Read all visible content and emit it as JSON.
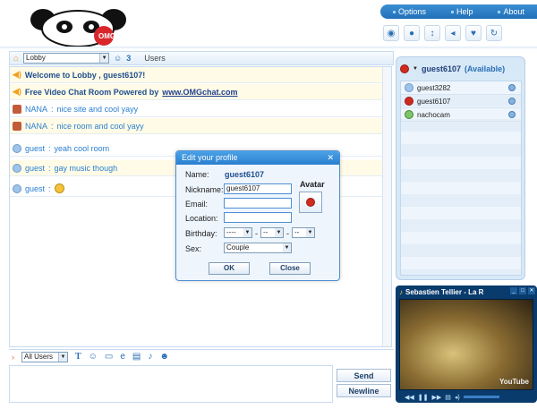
{
  "header": {
    "menu": [
      "Options",
      "Help",
      "About"
    ],
    "logo_text": "OMG"
  },
  "toolbar_icons": [
    "gamepad-icon",
    "webcam-icon",
    "resize-icon",
    "volume-icon",
    "heart-icon",
    "refresh-icon"
  ],
  "room": {
    "selected": "Lobby",
    "count": "3",
    "users_label": "Users"
  },
  "messages": [
    {
      "type": "sys",
      "text": "Welcome to Lobby , guest6107!"
    },
    {
      "type": "sys",
      "text": "Free Video Chat Room Powered by ",
      "link": "www.OMGchat.com"
    },
    {
      "type": "user",
      "user": "NANA",
      "text": "nice site and cool yayy",
      "avatar": "nana"
    },
    {
      "type": "user",
      "user": "NANA",
      "text": "nice room and cool yayy",
      "avatar": "nana"
    },
    {
      "type": "user",
      "user": "guest",
      "text": "yeah cool room",
      "avatar": "guest"
    },
    {
      "type": "user",
      "user": "guest",
      "text": "gay music though",
      "avatar": "guest"
    },
    {
      "type": "user",
      "user": "guest",
      "text": "",
      "avatar": "guest",
      "emoticon": true
    }
  ],
  "dialog": {
    "title": "Edit your profile",
    "name_label": "Name:",
    "name_value": "guest6107",
    "nickname_label": "Nickname:",
    "nickname_value": "guest6107",
    "email_label": "Email:",
    "location_label": "Location:",
    "birthday_label": "Birthday:",
    "birthday_year": "----",
    "birthday_month": "--",
    "birthday_day": "--",
    "sex_label": "Sex:",
    "sex_value": "Couple",
    "avatar_label": "Avatar",
    "ok": "OK",
    "close": "Close"
  },
  "input": {
    "to_selected": "All Users",
    "send": "Send",
    "newline": "Newline"
  },
  "right": {
    "me": "guest6107",
    "status": "(Available)",
    "users": [
      "guest3282",
      "guest6107",
      "nachocam"
    ]
  },
  "video": {
    "title": "Sebastien Tellier - La R",
    "watermark": "YouTube"
  }
}
